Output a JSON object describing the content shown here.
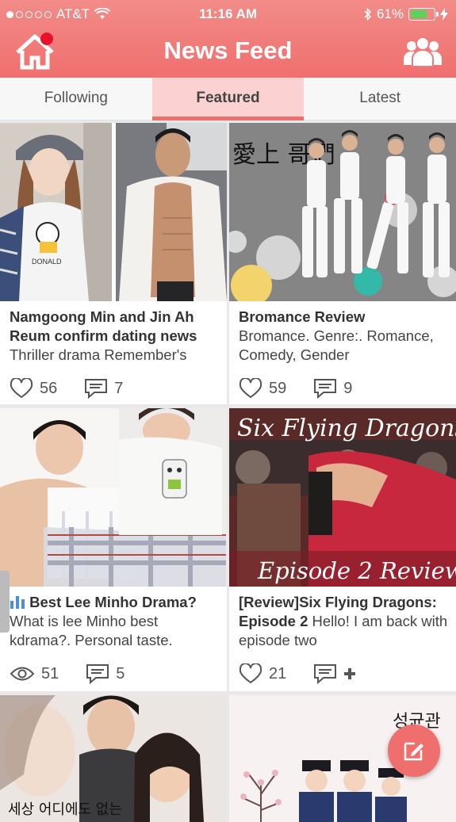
{
  "status_bar": {
    "carrier": "AT&T",
    "time": "11:16 AM",
    "battery": "61%"
  },
  "header": {
    "title": "News Feed"
  },
  "tabs": [
    {
      "label": "Following"
    },
    {
      "label": "Featured",
      "active": true
    },
    {
      "label": "Latest"
    }
  ],
  "posts": [
    {
      "title": "Namgoong Min and Jin Ah Reum confirm dating news",
      "excerpt": "Thriller drama Remember's",
      "likes": "56",
      "comments": "7"
    },
    {
      "title": "Bromance Review",
      "excerpt": "Bromance. Genre:. Romance, Comedy, Gender",
      "likes": "59",
      "comments": "9"
    },
    {
      "title": "Best Lee Minho Drama?",
      "excerpt": "What is lee Minho best kdrama?. Personal taste.",
      "views": "51",
      "comments": "5"
    },
    {
      "title": "[Review]Six Flying Dragons: Episode 2",
      "excerpt": "Hello! I am back with episode two",
      "likes": "21",
      "comments": "+"
    }
  ],
  "image_text": {
    "dragons_top": "Six Flying Dragons",
    "dragons_bottom": "Episode 2 Review",
    "shirt": "DONALD",
    "bromance_cjk": "愛上 哥們",
    "poster3": "세상 어디에도 없는",
    "poster4": "성균관"
  },
  "colors": {
    "accent": "#ef6f6e",
    "tab_active_bg": "#fbd2d1",
    "badge": "#e8112b"
  },
  "icons": [
    "home-icon",
    "users-icon",
    "heart-icon",
    "comment-icon",
    "eye-icon",
    "poll-icon",
    "plus-icon",
    "edit-icon"
  ]
}
